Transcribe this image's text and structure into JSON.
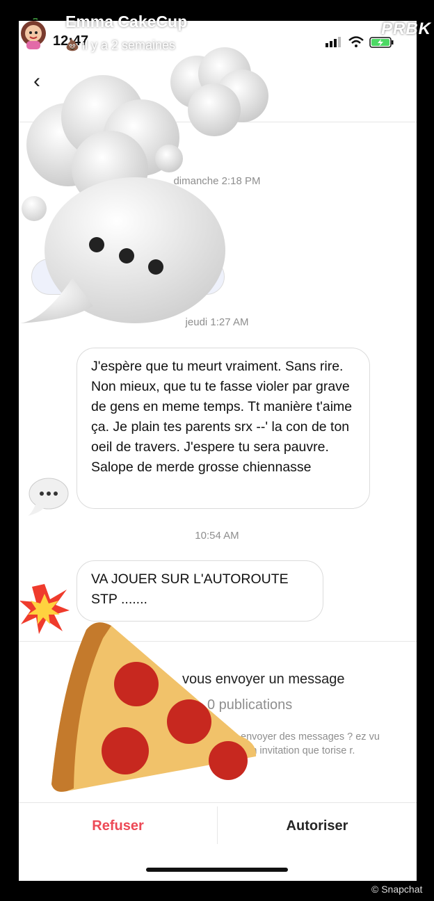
{
  "story": {
    "user_name": "Emma CakeCup",
    "posted": "il y a 2 semaines",
    "brand": "PRBK"
  },
  "status_bar": {
    "time": "12:47"
  },
  "messages": [
    {
      "timestamp": "dimanche 2:18 PM"
    },
    {
      "timestamp": "jeudi 1:27 AM",
      "text": "J'espère que tu meurt vraiment. Sans rire. Non mieux, que tu te fasse violer par grave de gens en meme temps. Tt manière t'aime ça. Je plain tes parents srx --' la con de ton oeil de travers. J'espere tu sera pauvre. Salope de merde grosse chiennasse"
    },
    {
      "timestamp": "10:54 AM",
      "text": "VA JOUER SUR L'AUTOROUTE STP ......."
    }
  ],
  "request_panel": {
    "title": "vous envoyer un message",
    "subtitle": "0 publications",
    "info": "envoyer des messages ? ez vu son invitation que torise r."
  },
  "actions": {
    "decline": "Refuser",
    "accept": "Autoriser"
  },
  "credit": "© Snapchat",
  "colors": {
    "decline": "#ed4956",
    "text": "#262626",
    "muted": "#8e8e8e"
  }
}
